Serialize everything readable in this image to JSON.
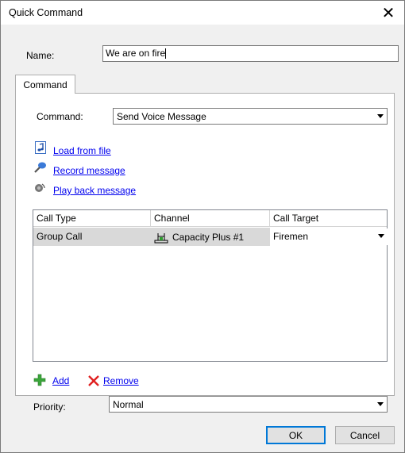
{
  "window": {
    "title": "Quick Command"
  },
  "name_field": {
    "label": "Name:",
    "value": "We are on fire"
  },
  "tabs": [
    {
      "label": "Command"
    }
  ],
  "command": {
    "label": "Command:",
    "value": "Send Voice Message"
  },
  "links": {
    "load": "Load from file",
    "record": "Record message",
    "playback": "Play back message"
  },
  "grid": {
    "columns": [
      "Call Type",
      "Channel",
      "Call Target"
    ],
    "rows": [
      {
        "call_type": "Group Call",
        "channel": "Capacity Plus #1",
        "call_target": "Firemen"
      }
    ]
  },
  "actions": {
    "add": "Add",
    "remove": "Remove"
  },
  "priority": {
    "label": "Priority:",
    "value": "Normal"
  },
  "buttons": {
    "ok": "OK",
    "cancel": "Cancel"
  },
  "colors": {
    "link": "#0000ee",
    "add_green": "#3aa53a",
    "remove_red": "#e02020",
    "selected_row": "#d9d9d9"
  }
}
